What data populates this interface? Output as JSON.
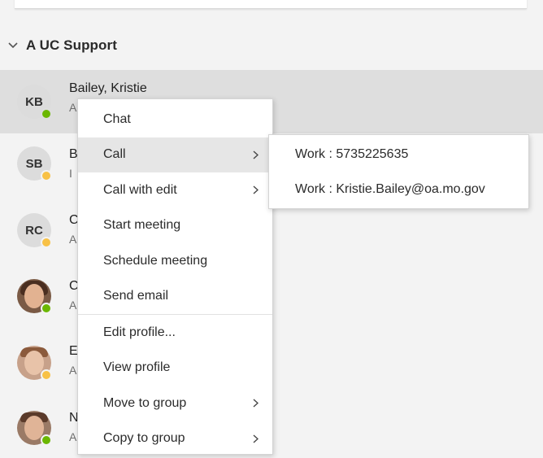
{
  "group": {
    "title": "A UC Support"
  },
  "contacts": [
    {
      "initials": "KB",
      "name": "Bailey, Kristie",
      "status": "A",
      "presence": "green",
      "photo": false
    },
    {
      "initials": "SB",
      "name": "B",
      "status": "I",
      "presence": "yellow",
      "photo": false
    },
    {
      "initials": "RC",
      "name": "C",
      "status": "A",
      "presence": "yellow",
      "photo": false
    },
    {
      "initials": "",
      "name": "C",
      "status": "A",
      "presence": "green",
      "photo": true
    },
    {
      "initials": "",
      "name": "E",
      "status": "A",
      "presence": "yellow",
      "photo": true
    },
    {
      "initials": "",
      "name": "N",
      "status": "A",
      "presence": "green",
      "photo": true
    }
  ],
  "context_menu": {
    "items": [
      {
        "label": "Chat",
        "submenu": false
      },
      {
        "label": "Call",
        "submenu": true
      },
      {
        "label": "Call with edit",
        "submenu": true
      },
      {
        "label": "Start meeting",
        "submenu": false
      },
      {
        "label": "Schedule meeting",
        "submenu": false
      },
      {
        "label": "Send email",
        "submenu": false
      },
      {
        "label": "Edit profile...",
        "submenu": false
      },
      {
        "label": "View profile",
        "submenu": false
      },
      {
        "label": "Move to group",
        "submenu": true
      },
      {
        "label": "Copy to group",
        "submenu": true
      }
    ]
  },
  "call_submenu": {
    "items": [
      {
        "label": "Work : 5735225635"
      },
      {
        "label": "Work : Kristie.Bailey@oa.mo.gov"
      }
    ]
  },
  "colors": {
    "background": "#f3f3f3",
    "selected_row": "#dedede",
    "menu_hover": "#e6e6e6",
    "presence_available": "#6bb700",
    "presence_away": "#f8c146"
  },
  "icons": {
    "group_toggle": "chevron-down-icon",
    "submenu_arrow": "chevron-right-icon"
  }
}
